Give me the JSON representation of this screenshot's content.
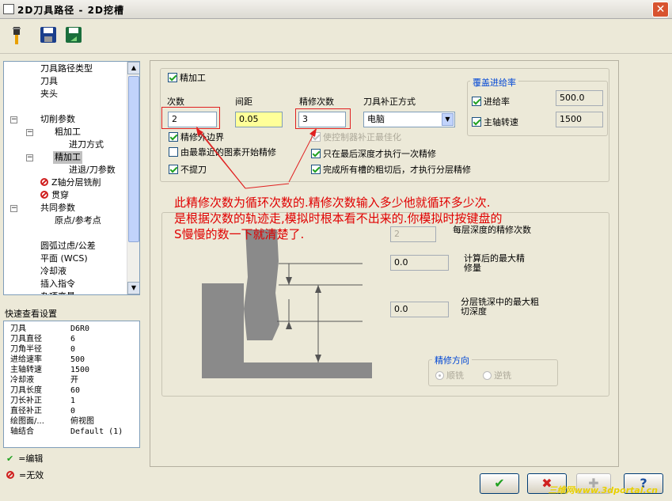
{
  "window": {
    "title": "2D刀具路径 - 2D挖槽",
    "close_symbol": "✕"
  },
  "toolbar": {
    "icons": [
      "tool-icon",
      "save-icon",
      "save-as-icon"
    ]
  },
  "tree": {
    "items": [
      {
        "label": "刀具路径类型"
      },
      {
        "label": "刀具"
      },
      {
        "label": "夹头"
      },
      {
        "label": "切削参数",
        "expander": "−"
      },
      {
        "label": "粗加工",
        "expander": "−"
      },
      {
        "label": "进刀方式"
      },
      {
        "label": "精加工",
        "expander": "−"
      },
      {
        "label": "进退/刀参数"
      },
      {
        "label": "Z轴分层铣削"
      },
      {
        "label": "贯穿"
      },
      {
        "label": "共同参数",
        "expander": "−"
      },
      {
        "label": "原点/参考点"
      },
      {
        "label": "圆弧过虑/公差"
      },
      {
        "label": "平面 (WCS)"
      },
      {
        "label": "冷却液"
      },
      {
        "label": "插入指令"
      },
      {
        "label": "杂项变量"
      }
    ]
  },
  "quick_view": {
    "title": "快速查看设置",
    "rows": [
      {
        "key": "刀具",
        "value": "D6R0"
      },
      {
        "key": "刀具直径",
        "value": "6"
      },
      {
        "key": "刀角半径",
        "value": "0"
      },
      {
        "key": "进给速率",
        "value": "500"
      },
      {
        "key": "主轴转速",
        "value": "1500"
      },
      {
        "key": "冷却液",
        "value": "开"
      },
      {
        "key": "刀具长度",
        "value": "60"
      },
      {
        "key": "刀长补正",
        "value": "1"
      },
      {
        "key": "直径补正",
        "value": "0"
      },
      {
        "key": "绘图面/...",
        "value": "俯视图"
      },
      {
        "key": "轴结合",
        "value": "Default (1)"
      }
    ]
  },
  "legend": {
    "edit": "=编辑",
    "disabled": "=无效"
  },
  "finish": {
    "enable_label": "精加工",
    "count_label": "次数",
    "count_value": "2",
    "spacing_label": "间距",
    "spacing_value": "0.05",
    "finish_passes_label": "精修次数",
    "finish_passes_value": "3",
    "comp_label": "刀具补正方式",
    "comp_value": "电脑",
    "opt_outer": "精修外边界",
    "opt_nearest": "由最靠近的图素开始精修",
    "opt_no_lift": "不提刀",
    "opt_optimize": "使控制器补正最佳化",
    "opt_final_depth": "只在最后深度才执行一次精修",
    "opt_after_rough": "完成所有槽的粗切后，才执行分层精修"
  },
  "override": {
    "title": "覆盖进给率",
    "feed_label": "进给率",
    "feed_value": "500.0",
    "spindle_label": "主轴转速",
    "spindle_value": "1500"
  },
  "depth": {
    "passes_value": "2",
    "passes_label": "每层深度的精修次数",
    "max_finish_value": "0.0",
    "max_finish_label": "计算后的最大精修量",
    "max_rough_value": "0.0",
    "max_rough_label": "分层铣深中的最大粗切深度",
    "direction_title": "精修方向",
    "climb": "顺铣",
    "conventional": "逆铣"
  },
  "annotation": "此精修次数为循环次数的.精修次数输入多少他就循环多少次.\n是根据次数的轨迹走,模拟时根本看不出来的.你模拟时按键盘的\nS慢慢的数一下就清楚了.",
  "buttons": {
    "ok": "✔",
    "cancel": "✖",
    "add": "✚",
    "help": "?"
  },
  "watermark": "三维网www.3dportal.cn",
  "colors": {
    "annotation": "#e00000",
    "accent": "#21a121"
  }
}
